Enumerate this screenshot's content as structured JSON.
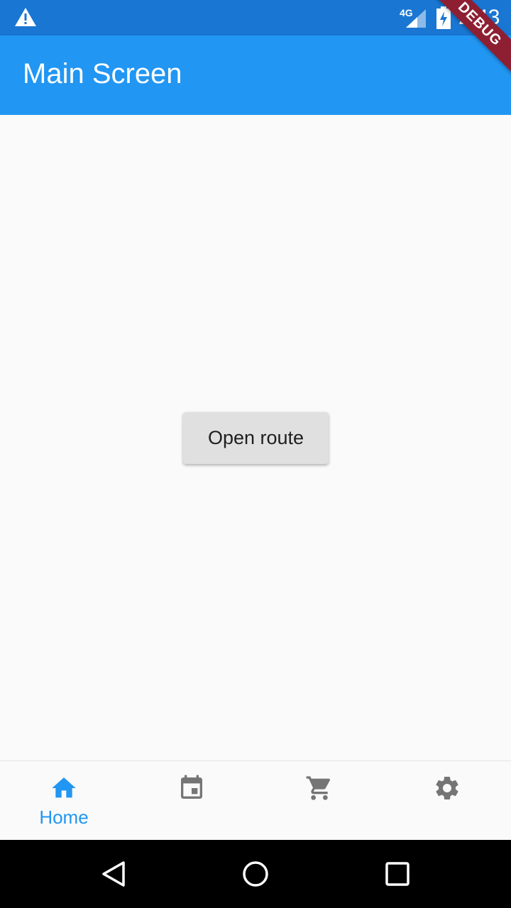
{
  "status_bar": {
    "network_label": "4G",
    "time": "2:43",
    "icons": [
      "warning-icon",
      "signal-icon",
      "battery-charging-icon"
    ]
  },
  "debug_banner": "DEBUG",
  "app_bar": {
    "title": "Main Screen"
  },
  "main": {
    "button_label": "Open route"
  },
  "bottom_nav": {
    "items": [
      {
        "icon": "home-icon",
        "label": "Home",
        "active": true
      },
      {
        "icon": "calendar-icon",
        "label": "",
        "active": false
      },
      {
        "icon": "cart-icon",
        "label": "",
        "active": false
      },
      {
        "icon": "settings-icon",
        "label": "",
        "active": false
      }
    ],
    "active_color": "#2196f3",
    "inactive_color": "#757575"
  },
  "system_nav": {
    "icons": [
      "back-icon",
      "home-circle-icon",
      "recents-icon"
    ]
  },
  "colors": {
    "primary": "#2196f3",
    "primary_dark": "#1976d2",
    "background": "#fafafa"
  }
}
